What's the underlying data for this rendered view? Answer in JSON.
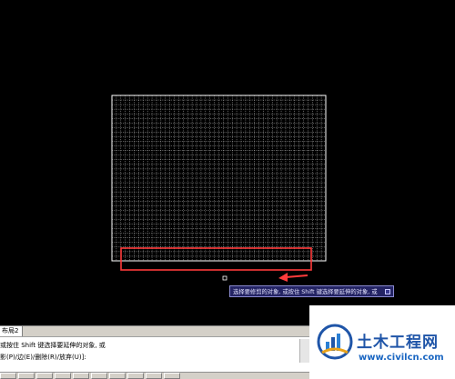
{
  "canvas": {
    "background_color": "#000000",
    "grid_color": "#ffffff",
    "highlight_color": "#ff3b3b"
  },
  "tooltip": {
    "text": "选择要修剪的对象, 或按住 Shift 键选择要延伸的对象, 或",
    "icon": "expand-icon"
  },
  "layout_tabs": {
    "active": "布局2"
  },
  "command_line": {
    "line1": "或按住 Shift 键选择要延伸的对象, 或",
    "line2": "影(P)/边(E)/删除(R)/放弃(U)]:"
  },
  "watermark": {
    "title": "土木工程网",
    "url": "www.civilcn.com"
  }
}
